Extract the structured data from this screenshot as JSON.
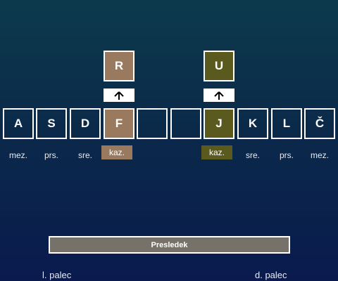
{
  "upper_keys": [
    {
      "label": "R"
    },
    {
      "label": "U"
    }
  ],
  "home_keys": [
    {
      "label": "A"
    },
    {
      "label": "S"
    },
    {
      "label": "D"
    },
    {
      "label": "F"
    },
    {
      "label": ""
    },
    {
      "label": ""
    },
    {
      "label": "J"
    },
    {
      "label": "K"
    },
    {
      "label": "L"
    },
    {
      "label": "Č"
    }
  ],
  "finger_labels": [
    {
      "label": "mez."
    },
    {
      "label": "prs."
    },
    {
      "label": "sre."
    },
    {
      "label": "kaz."
    },
    {
      "label": "kaz."
    },
    {
      "label": "sre."
    },
    {
      "label": "prs."
    },
    {
      "label": "mez."
    }
  ],
  "spacebar": {
    "label": "Presledek"
  },
  "thumbs": {
    "left": "l. palec",
    "right": "d. palec"
  },
  "icons": {
    "arrow": "arrow-up-icon"
  },
  "colors": {
    "left_index": "#9a7a5f",
    "right_index": "#5b5a1e"
  }
}
